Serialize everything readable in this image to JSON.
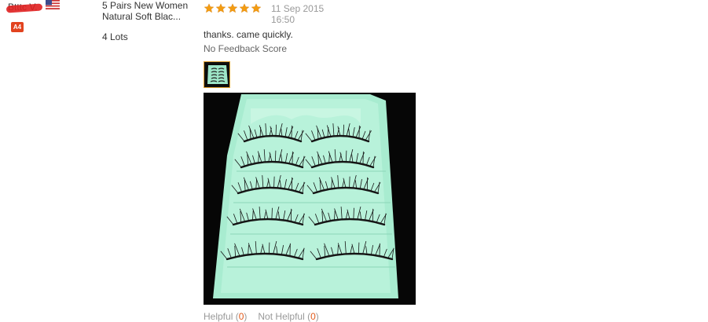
{
  "review": {
    "buyer_name": "Btttc V.",
    "country_flag_icon": "us-flag-icon",
    "buyer_level": "A4",
    "product_title": "5 Pairs New Women Natural Soft Blac...",
    "quantity": "4 Lots",
    "rating": 5,
    "rating_max": 5,
    "date": "11 Sep 2015",
    "time": "16:50",
    "feedback_text": "thanks. came quickly.",
    "feedback_score": "No Feedback Score",
    "helpful_label": "Helpful",
    "helpful_open": "(",
    "helpful_count": "0",
    "helpful_close": ")",
    "not_helpful_label": "Not Helpful",
    "not_helpful_open": "(",
    "not_helpful_count": "0",
    "not_helpful_close": ")"
  },
  "colors": {
    "star": "#f39c12",
    "badge": "#e2431f",
    "count": "#e05a1c",
    "tray": "#a8ecd0"
  }
}
